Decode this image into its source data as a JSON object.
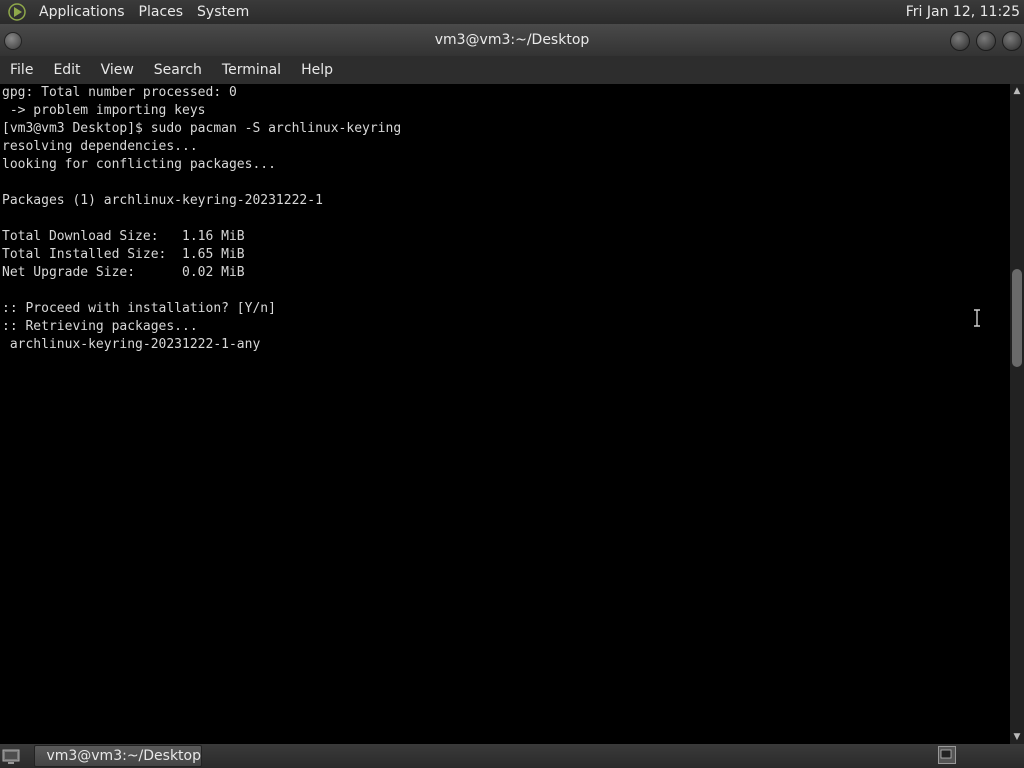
{
  "top_panel": {
    "menus": [
      "Applications",
      "Places",
      "System"
    ],
    "clock": "Fri Jan 12, 11:25"
  },
  "window": {
    "title": "vm3@vm3:~/Desktop",
    "menubar": [
      "File",
      "Edit",
      "View",
      "Search",
      "Terminal",
      "Help"
    ]
  },
  "terminal": {
    "lines": [
      "gpg: Total number processed: 0",
      " -> problem importing keys",
      "[vm3@vm3 Desktop]$ sudo pacman -S archlinux-keyring",
      "resolving dependencies...",
      "looking for conflicting packages...",
      "",
      "Packages (1) archlinux-keyring-20231222-1",
      "",
      "Total Download Size:   1.16 MiB",
      "Total Installed Size:  1.65 MiB",
      "Net Upgrade Size:      0.02 MiB",
      "",
      ":: Proceed with installation? [Y/n]",
      ":: Retrieving packages...",
      " archlinux-keyring-20231222-1-any"
    ]
  },
  "bottom_panel": {
    "task_label": "vm3@vm3:~/Desktop"
  },
  "colors": {
    "terminal_bg": "#000000",
    "terminal_fg": "#d8d8d8",
    "panel_bg": "#2d2d2d"
  }
}
